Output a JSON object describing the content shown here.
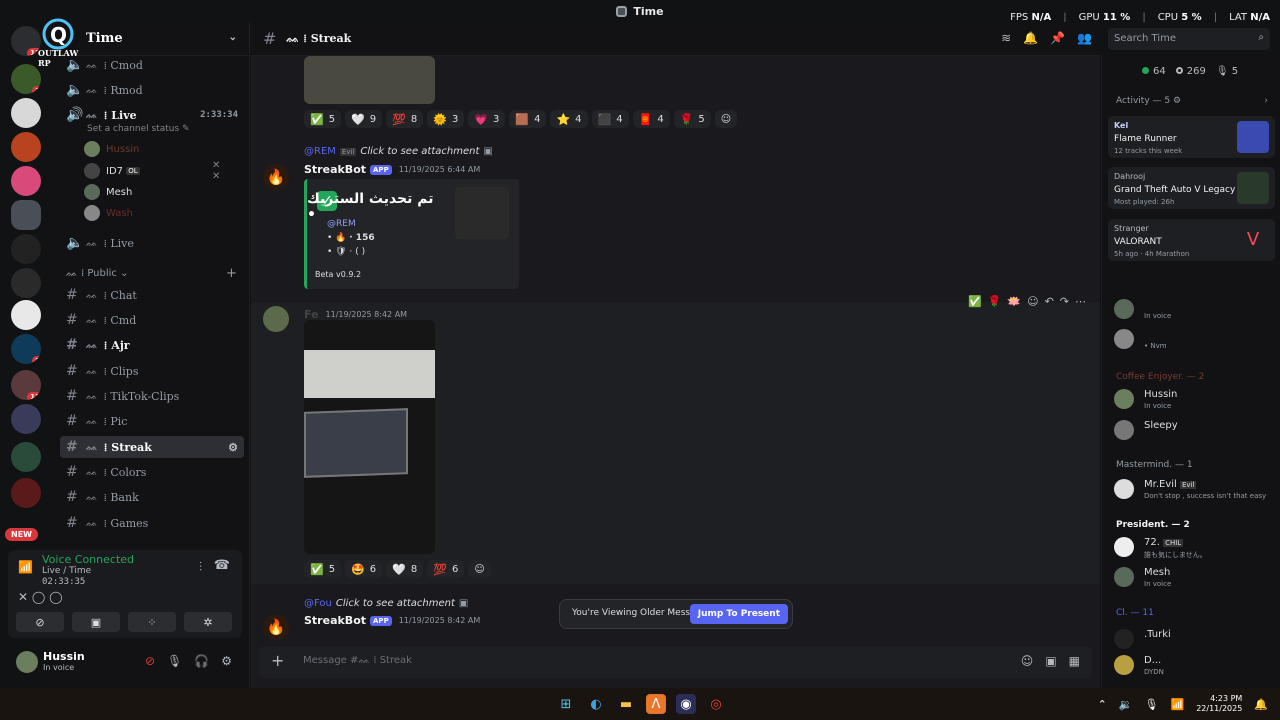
{
  "window": {
    "title": "Time"
  },
  "overlay": {
    "fps_label": "FPS",
    "fps": "N/A",
    "gpu_label": "GPU",
    "gpu": "11 %",
    "cpu_label": "CPU",
    "cpu": "5 %",
    "lat_label": "LAT",
    "lat": "N/A"
  },
  "rail": {
    "badges": [
      "13",
      "1",
      "2",
      "13",
      "4"
    ],
    "logo_text": "OUTLAW RP",
    "new_label": "NEW"
  },
  "server": {
    "name": "Time"
  },
  "channels": {
    "cmod": "Cmod",
    "rmod": "Rmod",
    "live": "Live",
    "live_time": "2:33:34",
    "set_status": "Set a channel status",
    "voice_users": [
      "Hussin",
      "ID7",
      "Mesh",
      "Wash"
    ],
    "id7_tag": "OL",
    "live2": "Live",
    "public_cat": "Public",
    "text": [
      {
        "name": "Chat"
      },
      {
        "name": "Cmd"
      },
      {
        "name": "Ajr"
      },
      {
        "name": "Clips"
      },
      {
        "name": "TikTok-Clips"
      },
      {
        "name": "Pic"
      },
      {
        "name": "Streak"
      },
      {
        "name": "Colors"
      },
      {
        "name": "Bank"
      },
      {
        "name": "Games"
      }
    ],
    "glyph": "ᨐ",
    "sep": "⁞"
  },
  "voice_panel": {
    "title": "Voice Connected",
    "sub": "Live / Time",
    "time": "02:33:35"
  },
  "user": {
    "name": "Hussin",
    "status": "In voice"
  },
  "chat_header": {
    "channel": "Streak"
  },
  "search": {
    "placeholder": "Search Time"
  },
  "messages": {
    "reactions1": [
      {
        "emo": "✅",
        "n": "5"
      },
      {
        "emo": "🤍",
        "n": "9"
      },
      {
        "emo": "💯",
        "n": "8"
      },
      {
        "emo": "🌞",
        "n": "3"
      },
      {
        "emo": "💗",
        "n": "3"
      },
      {
        "emo": "🟫",
        "n": "4"
      },
      {
        "emo": "⭐",
        "n": "4"
      },
      {
        "emo": "⬛",
        "n": "4"
      },
      {
        "emo": "🧧",
        "n": "4"
      },
      {
        "emo": "🌹",
        "n": "5"
      }
    ],
    "reply1": {
      "user": "@REM",
      "tag": "Evil",
      "text": "Click to see attachment"
    },
    "bot1": {
      "name": "StreakBot",
      "tag": "APP",
      "time": "11/19/2025 6:44 AM"
    },
    "embed": {
      "title": "تم تحديث الستريك •",
      "mention": "@REM",
      "streak": "· 156",
      "badges": "· ( )",
      "footer": "Beta v0.9.2"
    },
    "user_msg": {
      "name": "Fe",
      "time": "11/19/2025 8:42 AM"
    },
    "reactions2": [
      {
        "emo": "✅",
        "n": "5"
      },
      {
        "emo": "🤩",
        "n": "6"
      },
      {
        "emo": "🤍",
        "n": "8"
      },
      {
        "emo": "💯",
        "n": "6"
      }
    ],
    "reply2": {
      "user": "@Fou",
      "text": "Click to see attachment"
    },
    "bot2": {
      "name": "StreakBot",
      "tag": "APP",
      "time": "11/19/2025 8:42 AM"
    }
  },
  "older_bar": {
    "text": "You're Viewing Older Messages",
    "button": "Jump To Present"
  },
  "composer": {
    "placeholder": "Message #ᨐ ⁞ Streak"
  },
  "members": {
    "online": "64",
    "offline": "269",
    "voice": "5",
    "activity_head": "Activity — 5",
    "activities": [
      {
        "user": "Kel",
        "game": "Flame Runner",
        "meta": "12 tracks this week"
      },
      {
        "user": "Dahrooj",
        "game": "Grand Theft Auto V Legacy",
        "meta": "Most played: 26h"
      },
      {
        "user": "Stranger",
        "game": "VALORANT",
        "meta": "5h ago · 4h Marathon"
      }
    ],
    "groups": [
      {
        "title": "Coffee Enjoyer. — 2"
      },
      {
        "title": "Mastermind. — 1"
      },
      {
        "title": "President. — 2"
      },
      {
        "title": "Cl. — 11"
      }
    ],
    "list": [
      {
        "name": "Hussin",
        "sub": "In voice"
      },
      {
        "name": "Sleepy",
        "sub": ""
      },
      {
        "name": "Mr.Evil",
        "sub": "Don't stop , success isn't that easy"
      },
      {
        "name": "72.",
        "sub": "誰も気にしません。"
      },
      {
        "name": "Mesh",
        "sub": "In voice"
      },
      {
        "name": ".Turki",
        "sub": ""
      },
      {
        "name": "D...",
        "sub": "DYDN"
      }
    ],
    "top_list": [
      {
        "name": "",
        "sub": "In voice"
      },
      {
        "name": "",
        "sub": "• Nvm"
      }
    ],
    "evil_tag": "Evil",
    "chil_tag": "CHIL"
  },
  "taskbar": {
    "time": "4:23 PM",
    "date": "22/11/2025"
  }
}
